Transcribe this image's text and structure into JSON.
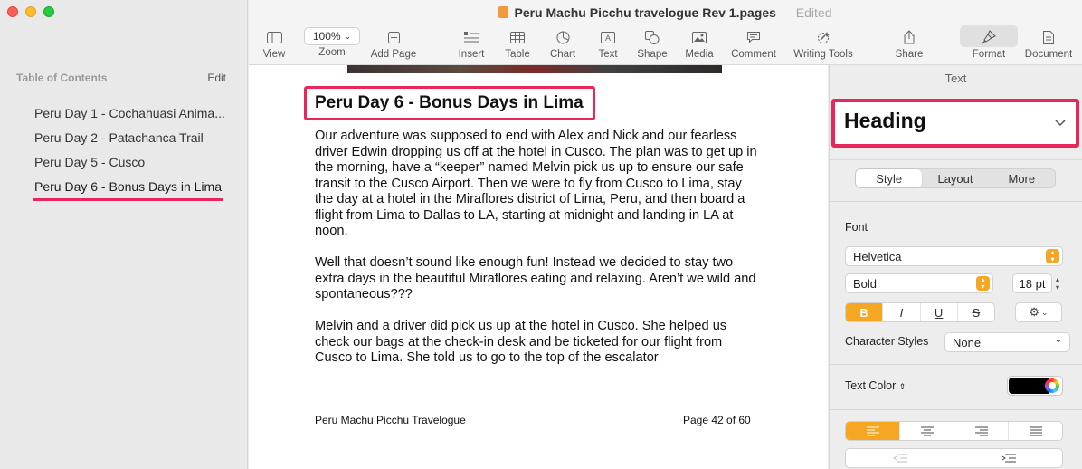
{
  "window": {
    "document_title": "Peru Machu Picchu travelogue Rev 1.pages",
    "status": "— Edited"
  },
  "sidebar": {
    "header": "Table of Contents",
    "edit_label": "Edit",
    "items": [
      {
        "label": "Peru Day 1 - Cochahuasi Anima..."
      },
      {
        "label": "Peru Day 2 - Patachanca Trail"
      },
      {
        "label": "Peru Day 5 - Cusco"
      },
      {
        "label": "Peru Day 6 - Bonus Days in Lima"
      }
    ]
  },
  "toolbar": {
    "view": "View",
    "zoom_value": "100%",
    "zoom": "Zoom",
    "add_page": "Add Page",
    "insert": "Insert",
    "table": "Table",
    "chart": "Chart",
    "text": "Text",
    "shape": "Shape",
    "media": "Media",
    "comment": "Comment",
    "writing_tools": "Writing Tools",
    "share": "Share",
    "format": "Format",
    "document": "Document"
  },
  "document": {
    "heading": "Peru Day 6 - Bonus Days in Lima",
    "paragraphs": [
      "Our adventure was supposed to end with Alex and Nick and our fearless driver Edwin dropping us off at the hotel in Cusco.  The plan was to get up in the morning, have a “keeper” named Melvin pick us up to ensure our safe transit to the Cusco Airport.  Then we were to fly from Cusco to Lima, stay the day at a hotel in the Miraflores district of Lima, Peru, and then board a flight from Lima to Dallas to LA, starting at midnight and landing in LA at noon.",
      "Well that doesn’t sound like enough fun!  Instead we decided to stay two extra days in the beautiful Miraflores eating and relaxing.  Aren’t we wild and spontaneous???",
      "Melvin and a driver did pick us up at the hotel in Cusco.  She helped us check our bags at the check-in desk and be ticketed for our flight from Cusco to Lima.  She told us to go to the top of the escalator"
    ],
    "footer_left": "Peru Machu Picchu Travelogue",
    "footer_right": "Page 42 of 60"
  },
  "format_panel": {
    "title": "Text",
    "paragraph_style": "Heading",
    "tabs": [
      "Style",
      "Layout",
      "More"
    ],
    "font_label": "Font",
    "font_family": "Helvetica",
    "font_weight": "Bold",
    "font_size": "18 pt",
    "bold": "B",
    "italic": "I",
    "underline": "U",
    "strikethrough": "S",
    "character_styles_label": "Character Styles",
    "character_style": "None",
    "text_color_label": "Text Color",
    "text_color": "#000000",
    "accent_color": "#f5a623",
    "highlight_color": "#e8265a"
  }
}
